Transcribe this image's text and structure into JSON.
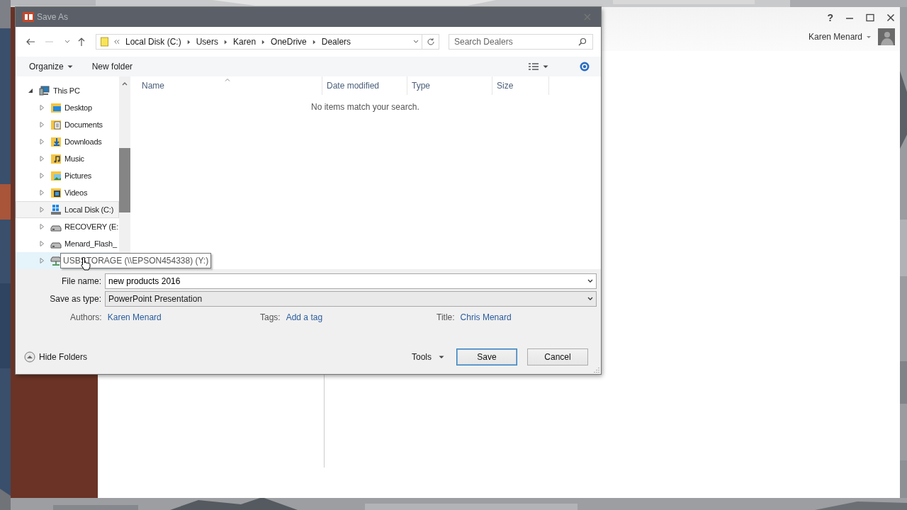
{
  "dialog": {
    "title": "Save As",
    "breadcrumb": [
      "Local Disk (C:)",
      "Users",
      "Karen",
      "OneDrive",
      "Dealers"
    ],
    "search": {
      "placeholder": "Search Dealers"
    },
    "toolbar": {
      "organize": "Organize",
      "new_folder": "New folder"
    },
    "tree": [
      {
        "label": "This PC",
        "kind": "pc",
        "expanded": true,
        "selected": false,
        "hovered": false,
        "children": [
          {
            "label": "Desktop",
            "kind": "desktop",
            "expanded": false,
            "selected": false,
            "hovered": false
          },
          {
            "label": "Documents",
            "kind": "documents",
            "expanded": false,
            "selected": false,
            "hovered": false
          },
          {
            "label": "Downloads",
            "kind": "downloads",
            "expanded": false,
            "selected": false,
            "hovered": false
          },
          {
            "label": "Music",
            "kind": "music",
            "expanded": false,
            "selected": false,
            "hovered": false
          },
          {
            "label": "Pictures",
            "kind": "pictures",
            "expanded": false,
            "selected": false,
            "hovered": false
          },
          {
            "label": "Videos",
            "kind": "videos",
            "expanded": false,
            "selected": false,
            "hovered": false
          },
          {
            "label": "Local Disk (C:)",
            "kind": "system-disk",
            "expanded": false,
            "selected": true,
            "hovered": false
          },
          {
            "label": "RECOVERY (E:",
            "kind": "drive",
            "expanded": false,
            "selected": false,
            "hovered": false
          },
          {
            "label": "Menard_Flash_",
            "kind": "drive",
            "expanded": false,
            "selected": false,
            "hovered": false
          },
          {
            "label": "USBSTORAGE (\\\\EPSON454338) (Y:)",
            "kind": "network",
            "expanded": false,
            "selected": false,
            "hovered": true
          }
        ]
      }
    ],
    "columns": [
      {
        "label": "Name",
        "sorted": true
      },
      {
        "label": "Date modified",
        "sorted": false
      },
      {
        "label": "Type",
        "sorted": false
      },
      {
        "label": "Size",
        "sorted": false
      }
    ],
    "empty_message": "No items match your search.",
    "file_name": {
      "label": "File name:",
      "value": "new products 2016"
    },
    "save_as_type": {
      "label": "Save as type:",
      "value": "PowerPoint Presentation"
    },
    "metadata": [
      {
        "label": "Authors:",
        "value": "Karen Menard"
      },
      {
        "label": "Tags:",
        "value": "Add a tag"
      },
      {
        "label": "Title:",
        "value": "Chris Menard"
      }
    ],
    "hide_folders": "Hide Folders",
    "tools": "Tools",
    "buttons": [
      {
        "label": "Save",
        "default": true
      },
      {
        "label": "Cancel",
        "default": false
      }
    ]
  },
  "app": {
    "help": "?",
    "user": "Karen Menard"
  }
}
